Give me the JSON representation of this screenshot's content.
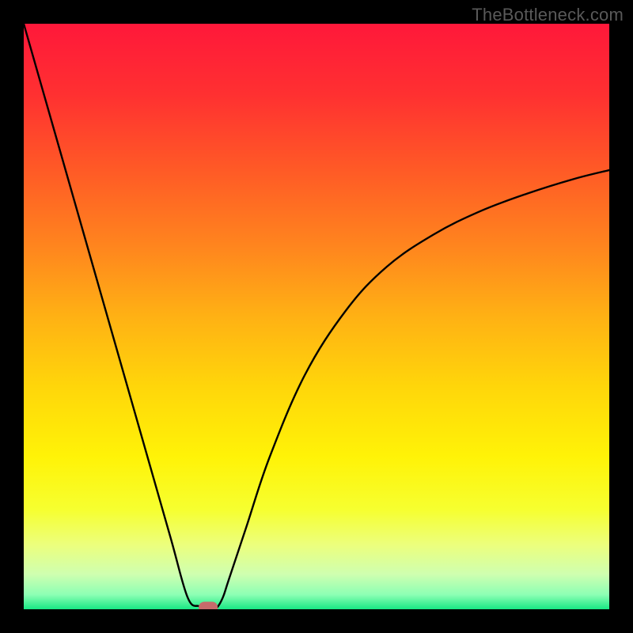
{
  "watermark": "TheBottleneck.com",
  "chart_data": {
    "type": "line",
    "title": "",
    "xlabel": "",
    "ylabel": "",
    "xlim": [
      0,
      100
    ],
    "ylim": [
      0,
      100
    ],
    "x": [
      0,
      5,
      10,
      15,
      20,
      25,
      28,
      30,
      31,
      32,
      33,
      34,
      35,
      38,
      42,
      48,
      55,
      62,
      70,
      78,
      86,
      94,
      100
    ],
    "values": [
      100,
      82.5,
      65,
      47.5,
      30,
      12.5,
      2,
      0.5,
      0,
      0,
      0.3,
      2,
      5,
      14,
      26,
      40,
      51,
      58.5,
      64,
      68,
      71,
      73.5,
      75
    ],
    "marker": {
      "x": 31.5,
      "y": 0,
      "color": "#c66b6b"
    },
    "gradient_stops": [
      {
        "offset": 0.0,
        "color": "#ff183a"
      },
      {
        "offset": 0.12,
        "color": "#ff3031"
      },
      {
        "offset": 0.25,
        "color": "#ff5a26"
      },
      {
        "offset": 0.38,
        "color": "#ff851e"
      },
      {
        "offset": 0.5,
        "color": "#ffb114"
      },
      {
        "offset": 0.62,
        "color": "#ffd60a"
      },
      {
        "offset": 0.74,
        "color": "#fff307"
      },
      {
        "offset": 0.83,
        "color": "#f6ff30"
      },
      {
        "offset": 0.89,
        "color": "#ecff7d"
      },
      {
        "offset": 0.94,
        "color": "#cfffb0"
      },
      {
        "offset": 0.975,
        "color": "#8dffb4"
      },
      {
        "offset": 1.0,
        "color": "#18e884"
      }
    ]
  }
}
